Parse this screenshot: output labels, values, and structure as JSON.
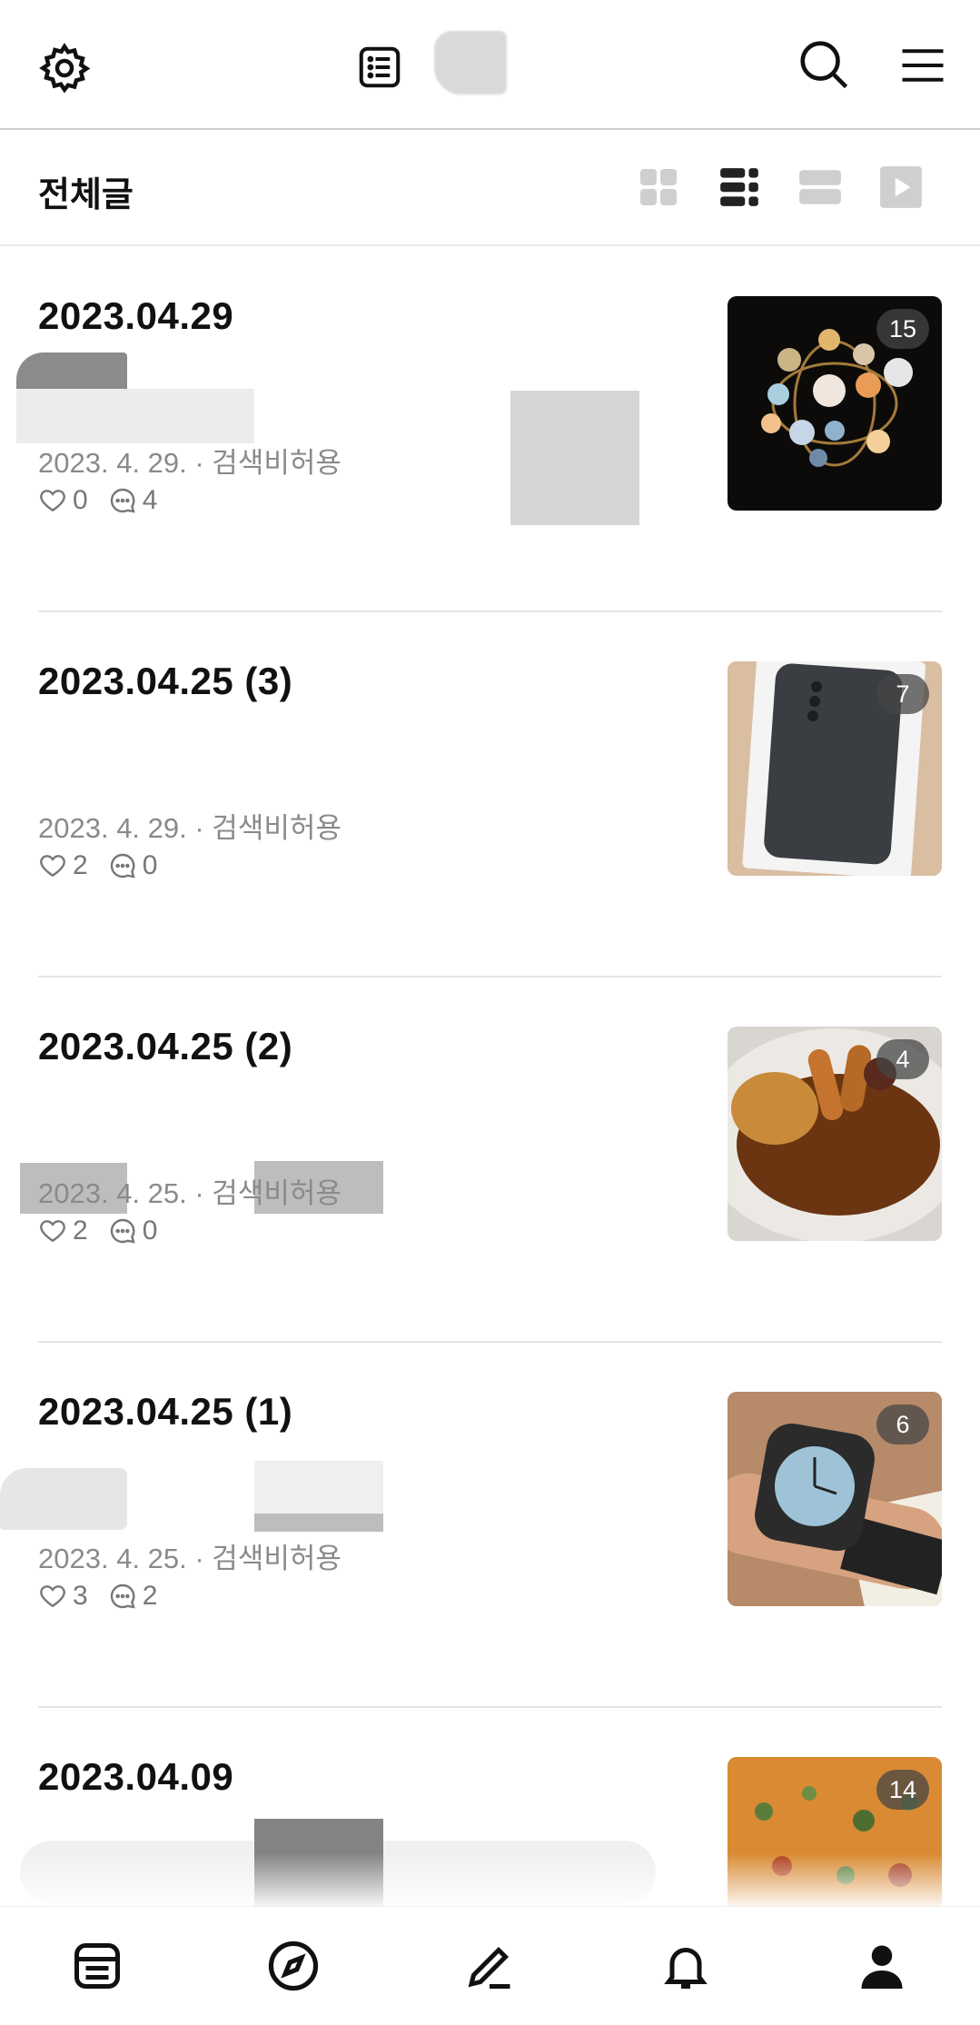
{
  "header": {
    "settings_icon": "gear-icon",
    "list_icon": "list-icon",
    "search_icon": "search-icon",
    "menu_icon": "hamburger-menu-icon"
  },
  "subheader": {
    "title": "전체글",
    "view_modes": [
      "grid-view-icon",
      "list-view-icon",
      "card-view-icon",
      "video-view-icon"
    ],
    "active_view": "list-view-icon"
  },
  "posts": [
    {
      "title": "2023.04.29",
      "meta": "2023. 4. 29. · 검색비허용",
      "likes": "0",
      "comments": "4",
      "photo_count": "15",
      "photo": "chandelier"
    },
    {
      "title": "2023.04.25 (3)",
      "meta": "2023. 4. 29. · 검색비허용",
      "likes": "2",
      "comments": "0",
      "photo_count": "7",
      "photo": "smartphone"
    },
    {
      "title": "2023.04.25 (2)",
      "meta": "2023. 4. 25. · 검색비허용",
      "likes": "2",
      "comments": "0",
      "photo_count": "4",
      "photo": "curry"
    },
    {
      "title": "2023.04.25 (1)",
      "meta": "2023. 4. 25. · 검색비허용",
      "likes": "3",
      "comments": "2",
      "photo_count": "6",
      "photo": "smartwatch"
    },
    {
      "title": "2023.04.09",
      "meta": "",
      "likes": "",
      "comments": "",
      "photo_count": "14",
      "photo": "pancake"
    }
  ],
  "bottom_nav": [
    "feed-icon",
    "explore-compass-icon",
    "write-pen-icon",
    "notification-bell-icon",
    "my-profile-icon"
  ],
  "colors": {
    "text": "#111111",
    "meta": "#8a8a8a",
    "divider": "#e5e5e5",
    "badge": "#464646"
  }
}
